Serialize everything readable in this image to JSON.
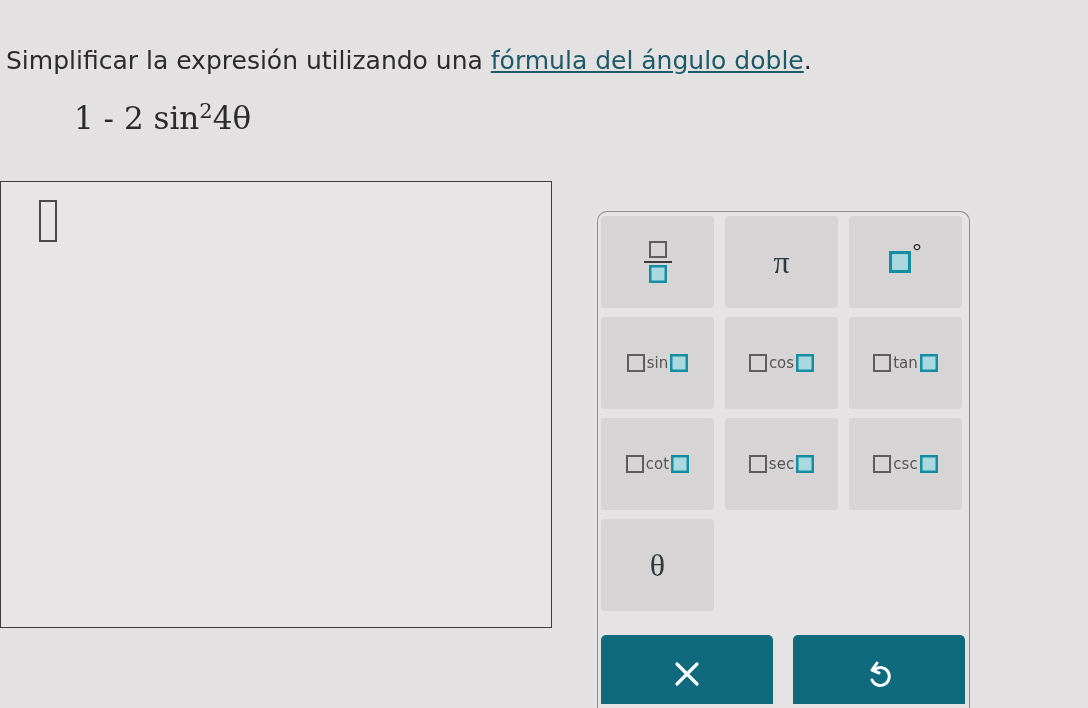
{
  "instruction": {
    "before": "Simplificar la expresión utilizando una ",
    "link": "fórmula del ángulo doble",
    "after": "."
  },
  "expression": "1 - 2 sin$^{2}$4θ",
  "keypad": {
    "keys": [
      {
        "kind": "fraction"
      },
      {
        "kind": "symbol",
        "label": "π"
      },
      {
        "kind": "degree",
        "label": "°"
      },
      {
        "kind": "function",
        "label": "sin"
      },
      {
        "kind": "function",
        "label": "cos"
      },
      {
        "kind": "function",
        "label": "tan"
      },
      {
        "kind": "function",
        "label": "cot"
      },
      {
        "kind": "function",
        "label": "sec"
      },
      {
        "kind": "function",
        "label": "csc"
      },
      {
        "kind": "symbol",
        "label": "θ"
      }
    ],
    "actions": [
      {
        "kind": "clear"
      },
      {
        "kind": "undo"
      }
    ]
  }
}
